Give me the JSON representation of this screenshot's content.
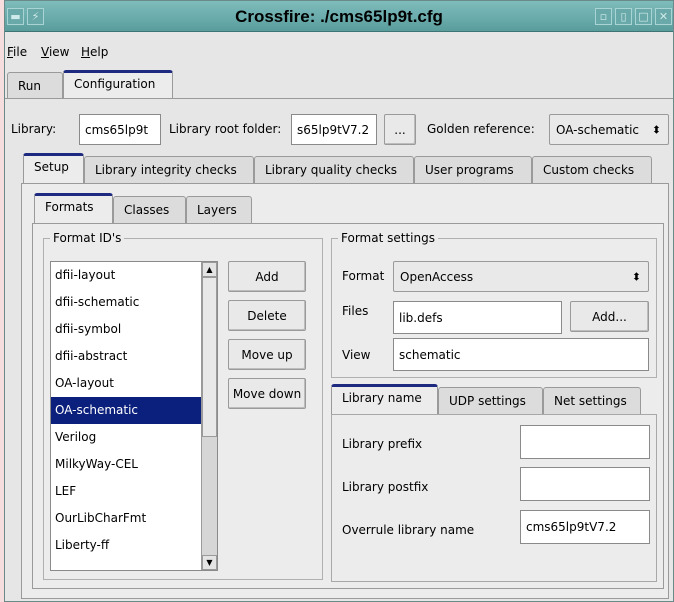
{
  "window": {
    "title": "Crossfire: ./cms65lp9t.cfg",
    "titlebar_color": "#5a9d9d"
  },
  "menu": {
    "file": {
      "underlined": "F",
      "rest": "ile"
    },
    "view": {
      "underlined": "V",
      "rest": "iew"
    },
    "help": {
      "underlined": "H",
      "rest": "elp"
    }
  },
  "main_tabs": [
    {
      "label": "Run",
      "active": false
    },
    {
      "label": "Configuration",
      "active": true
    }
  ],
  "library_bar": {
    "library_label": "Library:",
    "library_value": "cms65lp9t",
    "root_label": "Library root folder:",
    "root_value": "s65lp9tV7.2",
    "browse_label": "...",
    "golden_label": "Golden reference:",
    "golden_value": "OA-schematic"
  },
  "config_tabs": [
    {
      "label": "Setup",
      "active": true
    },
    {
      "label": "Library integrity checks",
      "active": false
    },
    {
      "label": "Library quality checks",
      "active": false
    },
    {
      "label": "User programs",
      "active": false
    },
    {
      "label": "Custom checks",
      "active": false
    }
  ],
  "setup_tabs": [
    {
      "label": "Formats",
      "active": true
    },
    {
      "label": "Classes",
      "active": false
    },
    {
      "label": "Layers",
      "active": false
    }
  ],
  "format_ids": {
    "title": "Format ID's",
    "items": [
      "dfii-layout",
      "dfii-schematic",
      "dfii-symbol",
      "dfii-abstract",
      "OA-layout",
      "OA-schematic",
      "Verilog",
      "MilkyWay-CEL",
      "LEF",
      "OurLibCharFmt",
      "Liberty-ff"
    ],
    "selected_index": 5,
    "buttons": {
      "add": "Add",
      "delete": "Delete",
      "move_up": "Move up",
      "move_down": "Move down"
    }
  },
  "format_settings": {
    "title": "Format settings",
    "format_label": "Format",
    "format_value": "OpenAccess",
    "files_label": "Files",
    "files_value": "lib.defs",
    "files_add": "Add...",
    "view_label": "View",
    "view_value": "schematic"
  },
  "format_tabs": [
    {
      "label": "Library name",
      "active": true
    },
    {
      "label": "UDP settings",
      "active": false
    },
    {
      "label": "Net settings",
      "active": false
    }
  ],
  "library_name": {
    "prefix_label": "Library prefix",
    "prefix_value": "",
    "postfix_label": "Library postfix",
    "postfix_value": "",
    "overrule_label": "Overrule library name",
    "overrule_value": "cms65lp9tV7.2"
  },
  "colors": {
    "selection": "#0b1f7c",
    "active_tab_accent": "#1e2a80",
    "window_bg": "#e6e6e6"
  }
}
